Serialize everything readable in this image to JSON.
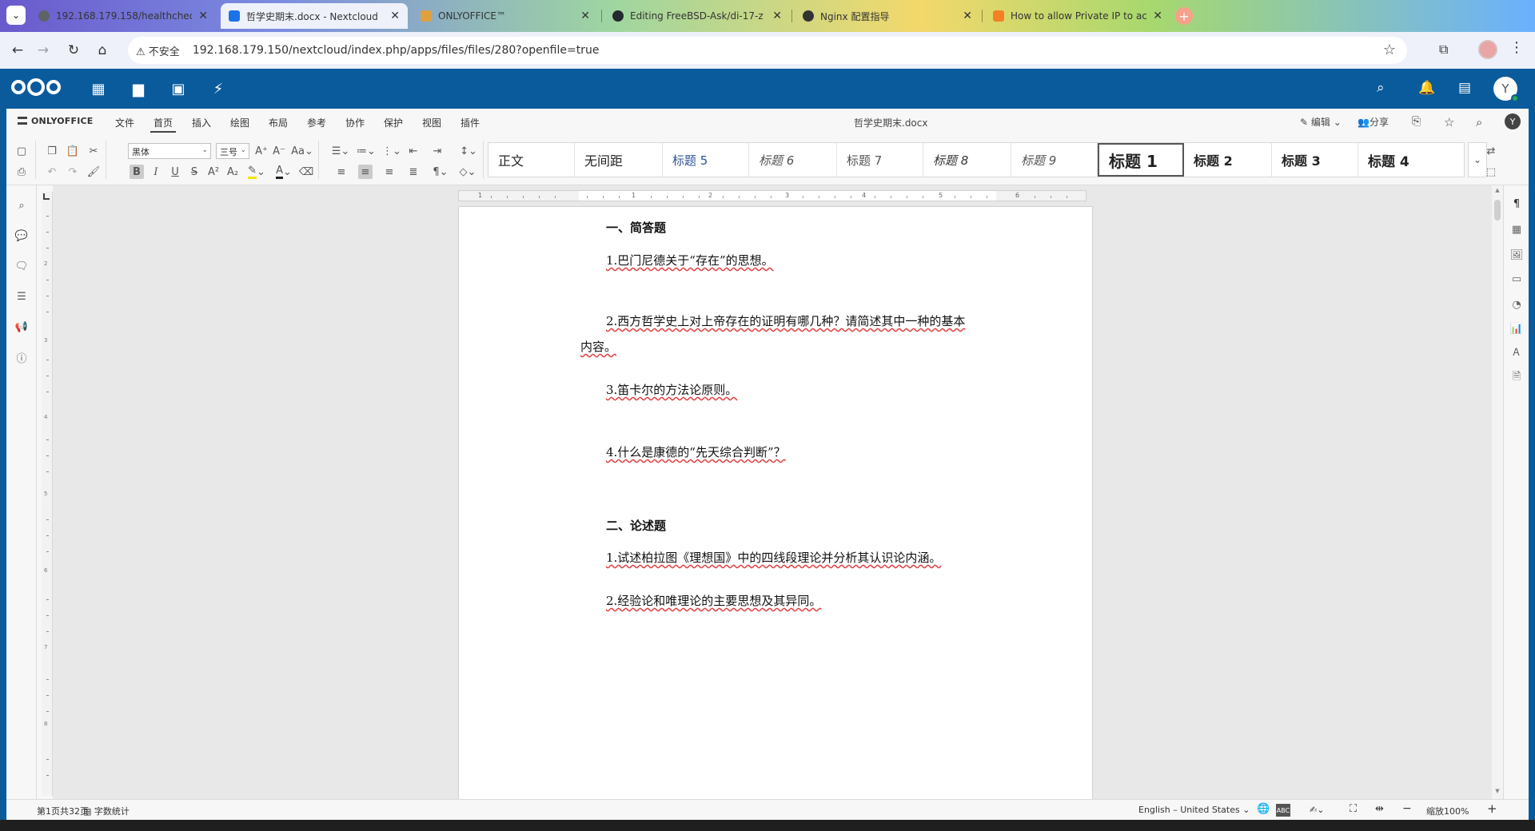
{
  "browser": {
    "tabs": [
      {
        "title": "192.168.179.158/healthcheck",
        "favicon_color": "#5f6368",
        "active": false
      },
      {
        "title": "哲学史期末.docx - Nextcloud",
        "favicon_color": "#1a73e8",
        "active": true
      },
      {
        "title": "ONLYOFFICE™",
        "favicon_color": "#e0a040",
        "active": false
      },
      {
        "title": "Editing FreeBSD-Ask/di-17-z",
        "favicon_color": "#24292f",
        "active": false
      },
      {
        "title": "Nginx 配置指导",
        "favicon_color": "#333333",
        "active": false
      },
      {
        "title": "How to allow Private IP to ac",
        "favicon_color": "#f48024",
        "active": false
      }
    ],
    "new_tab": "+",
    "insecure_label": "不安全",
    "url": "192.168.179.150/nextcloud/index.php/apps/files/files/280?openfile=true"
  },
  "nextcloud": {
    "brand_color": "#0a5b9c",
    "user_initial": "Y"
  },
  "onlyoffice": {
    "brand": "ONLYOFFICE",
    "menus": [
      "文件",
      "首页",
      "插入",
      "绘图",
      "布局",
      "参考",
      "协作",
      "保护",
      "视图",
      "插件"
    ],
    "active_menu": "首页",
    "doc_title": "哲学史期末.docx",
    "edit_label": "编辑",
    "share_label": "分享",
    "user_initial": "Y",
    "font_name": "黑体",
    "font_size": "三号",
    "styles": [
      "正文",
      "无间距",
      "标题 5",
      "标题 6",
      "标题 7",
      "标题 8",
      "标题 9",
      "标题 1",
      "标题 2",
      "标题 3",
      "标题 4"
    ],
    "selected_style": "标题 1"
  },
  "document": {
    "lines": [
      "一、简答题",
      "1.巴门尼德关于“存在”的思想。",
      "2.西方哲学史上对上帝存在的证明有哪几种？请简述其中一种的基本",
      "内容。",
      "3.笛卡尔的方法论原则。",
      "4.什么是康德的“先天综合判断”？",
      "二、论述题",
      "1.试述柏拉图《理想国》中的四线段理论并分析其认识论内涵。",
      "2.经验论和唯理论的主要思想及其异同。"
    ]
  },
  "status": {
    "page": "第1页共32页",
    "word_count": "字数统计",
    "language": "English – United States",
    "zoom": "缩放100%"
  }
}
